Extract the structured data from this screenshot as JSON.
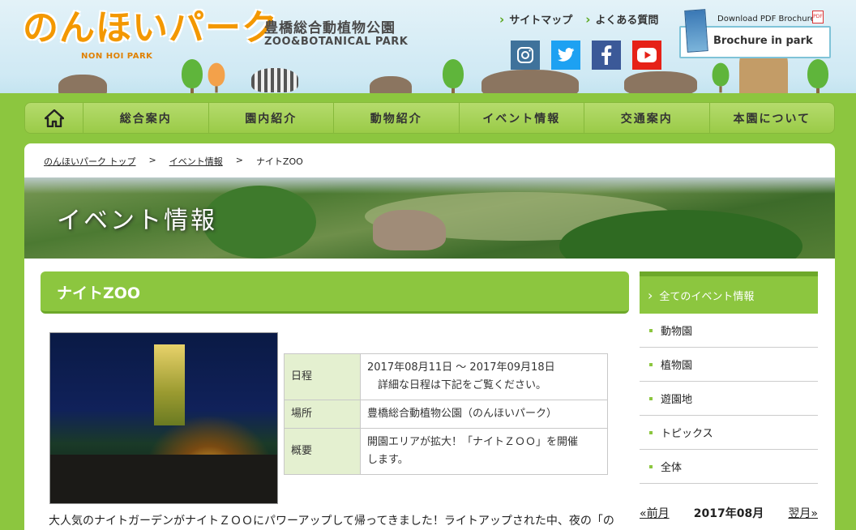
{
  "header": {
    "logo_text": "のんほいパーク",
    "logo_sub": "NON HOI PARK",
    "park_name_jp": "豊橋総合動植物公園",
    "park_name_en": "ZOO&BOTANICAL PARK",
    "top_links": [
      "サイトマップ",
      "よくある質問"
    ],
    "social_icons": [
      "instagram-icon",
      "twitter-icon",
      "facebook-icon",
      "youtube-icon"
    ],
    "brochure_download": "Download PDF Brochure",
    "brochure_label": "Brochure in park",
    "pdf_label": "PDF"
  },
  "nav": {
    "home_icon": "home-icon",
    "items": [
      "総合案内",
      "園内紹介",
      "動物紹介",
      "イベント情報",
      "交通案内",
      "本園について"
    ]
  },
  "breadcrumb": {
    "items": [
      "のんほいパーク トップ",
      "イベント情報",
      "ナイトZOO"
    ],
    "separator": ">"
  },
  "banner": {
    "title": "イベント情報"
  },
  "event": {
    "title": "ナイトZOO",
    "table": [
      {
        "label": "日程",
        "lines": [
          "2017年08月11日 ～ 2017年09月18日",
          "　詳細な日程は下記をご覧ください。"
        ]
      },
      {
        "label": "場所",
        "lines": [
          "豊橋総合動植物公園（のんほいパーク）"
        ]
      },
      {
        "label": "概要",
        "lines": [
          "開園エリアが拡大！「ナイトＺＯＯ」を開催",
          "します。"
        ]
      }
    ],
    "description": "大人気のナイトガーデンがナイトＺＯＯにパワーアップして帰ってきました！ライトアップされた中、夜の「の"
  },
  "sidebar": {
    "active": "全てのイベント情報",
    "items": [
      "動物園",
      "植物園",
      "遊園地",
      "トピックス",
      "全体"
    ]
  },
  "month_nav": {
    "prev": "«前月",
    "current": "2017年08月",
    "next": "翌月»"
  },
  "colors": {
    "accent_green": "#8cc63f",
    "logo_orange": "#f39800"
  }
}
